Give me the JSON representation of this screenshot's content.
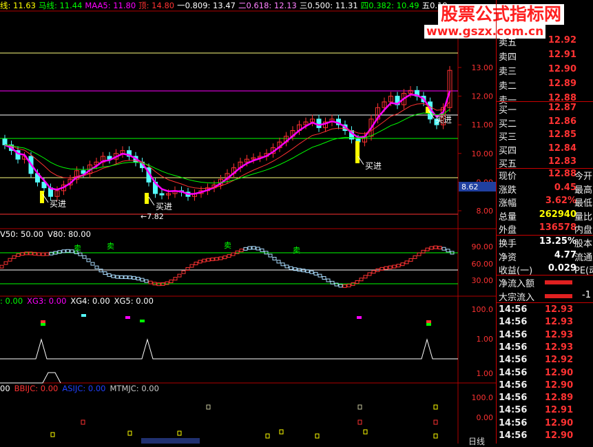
{
  "header": {
    "items": [
      {
        "label": "线:",
        "value": "11.63",
        "color": "#ffff00"
      },
      {
        "label": "马线:",
        "value": "11.44",
        "color": "#00ff00"
      },
      {
        "label": "MAA5:",
        "value": "11.80",
        "color": "#ff00ff"
      },
      {
        "label": "顶:",
        "value": "14.80",
        "color": "#ff3232"
      },
      {
        "label": "一0.809:",
        "value": "13.47",
        "color": "#ffffff"
      },
      {
        "label": "二0.618:",
        "value": "12.13",
        "color": "#ff80ff"
      },
      {
        "label": "三0.500:",
        "value": "11.31",
        "color": "#ffffff"
      },
      {
        "label": "四0.382:",
        "value": "10.49",
        "color": "#00ff00"
      },
      {
        "label": "五0.19",
        "value": "",
        "color": "#ffffff"
      }
    ]
  },
  "watermark": {
    "title": "股票公式指标网",
    "url": "www.gszx.com.cn"
  },
  "main_price_axis": [
    "13.00",
    "12.00",
    "11.00",
    "10.00",
    "9.00",
    "8.00"
  ],
  "current_price_tag": "8.62",
  "annotations": {
    "buy": "买进",
    "low": "←7.82"
  },
  "ind1": {
    "title": [
      "V50: 50.00",
      "V80: 80.00"
    ],
    "axis": [
      "90.00",
      "60.00",
      "30.00"
    ],
    "sell_mark": "卖",
    "buy_mark": "买"
  },
  "ind2": {
    "title": [
      {
        "t": ": 0.00",
        "c": "#00ff00"
      },
      {
        "t": "XG3: 0.00",
        "c": "#ff00ff"
      },
      {
        "t": "XG4: 0.00",
        "c": "#ffffff"
      },
      {
        "t": "XG5: 0.00",
        "c": "#ffffff"
      }
    ],
    "axis": [
      "100.0",
      "1.00",
      "1.00"
    ]
  },
  "ind3": {
    "title": [
      {
        "t": "00",
        "c": "#ffffff"
      },
      {
        "t": "BBIJC: 0.00",
        "c": "#ff3232"
      },
      {
        "t": "ASIJC: 0.00",
        "c": "#2040ff"
      },
      {
        "t": "MTMJC: 0.00",
        "c": "#c8c8c8"
      }
    ],
    "axis": [
      "100.0",
      "0.00"
    ],
    "bottom_tag": "日线"
  },
  "quotes": {
    "sell": [
      {
        "label": "卖五",
        "price": "12.92"
      },
      {
        "label": "卖四",
        "price": "12.91"
      },
      {
        "label": "卖三",
        "price": "12.90"
      },
      {
        "label": "卖二",
        "price": "12.89"
      },
      {
        "label": "卖一",
        "price": "12.88"
      }
    ],
    "buy": [
      {
        "label": "买一",
        "price": "12.87"
      },
      {
        "label": "买二",
        "price": "12.86"
      },
      {
        "label": "买三",
        "price": "12.85"
      },
      {
        "label": "买四",
        "price": "12.84"
      },
      {
        "label": "买五",
        "price": "12.83"
      }
    ]
  },
  "stats1": [
    {
      "label": "现价",
      "value": "12.88",
      "vcolor": "#ff3232",
      "ext": "今开"
    },
    {
      "label": "涨跌",
      "value": "0.45",
      "vcolor": "#ff3232",
      "ext": "最高"
    },
    {
      "label": "涨幅",
      "value": "3.62%",
      "vcolor": "#ff3232",
      "ext": "最低"
    },
    {
      "label": "总量",
      "value": "262940",
      "vcolor": "#ffff00",
      "ext": "量比"
    },
    {
      "label": "外盘",
      "value": "136578",
      "vcolor": "#ff3232",
      "ext": "内盘"
    }
  ],
  "stats2": [
    {
      "label": "换手",
      "value": "13.25%",
      "vcolor": "#ffffff",
      "ext": "股本"
    },
    {
      "label": "净资",
      "value": "4.77",
      "vcolor": "#ffffff",
      "ext": "流通"
    },
    {
      "label": "收益(一)",
      "value": "0.029",
      "vcolor": "#ffffff",
      "ext": "PE(动"
    }
  ],
  "flows": [
    {
      "label": "净流入额"
    },
    {
      "label": "大宗流入",
      "value": "-1"
    }
  ],
  "ticks": [
    {
      "time": "14:56",
      "price": "12.93"
    },
    {
      "time": "14:56",
      "price": "12.93"
    },
    {
      "time": "14:56",
      "price": "12.93"
    },
    {
      "time": "14:56",
      "price": "12.93"
    },
    {
      "time": "14:56",
      "price": "12.92"
    },
    {
      "time": "14:56",
      "price": "12.90"
    },
    {
      "time": "14:56",
      "price": "12.90"
    },
    {
      "time": "14:56",
      "price": "12.89"
    },
    {
      "time": "14:56",
      "price": "12.91"
    },
    {
      "time": "14:56",
      "price": "12.90"
    },
    {
      "time": "14:56",
      "price": "12.90"
    }
  ],
  "colors": {
    "up": "#ff3232",
    "down": "#54fcfc",
    "ma_purple": "#ff00ff",
    "ma_yellow": "#ffff00",
    "ma_green": "#00ff00",
    "ma_red": "#ff3232",
    "grid_red": "#b00000"
  }
}
